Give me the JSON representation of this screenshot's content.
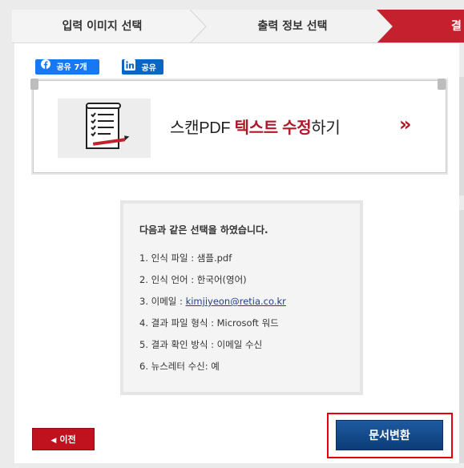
{
  "steps": [
    {
      "label": "입력 이미지 선택"
    },
    {
      "label": "출력 정보 선택"
    },
    {
      "label": "결"
    }
  ],
  "share": {
    "facebook_label": "공유 7개",
    "linkedin_label": "공유"
  },
  "banner": {
    "text_before": "스캔PDF ",
    "text_highlight_1": "텍스트 수정",
    "text_after": "하기",
    "arrow": "»"
  },
  "summary": {
    "title": "다음과 같은 선택을 하였습니다.",
    "items": [
      {
        "label": "1. 인식 파일 : ",
        "value": "샘플.pdf"
      },
      {
        "label": "2. 인식 언어 : ",
        "value": "한국어(영어)"
      },
      {
        "label": "3. 이메일 : ",
        "value": "kimjiyeon@retia.co.kr"
      },
      {
        "label": "4. 결과 파일 형식 : ",
        "value": "Microsoft 워드"
      },
      {
        "label": "5. 결과 확인 방식 : ",
        "value": "이메일 수신"
      },
      {
        "label": "6. 뉴스레터 수신: ",
        "value": "예"
      }
    ]
  },
  "buttons": {
    "prev_label": "이전",
    "convert_label": "문서변환"
  },
  "colors": {
    "active_step": "#c4202e",
    "accent_red": "#b0182a",
    "convert_blue": "#134a8a"
  }
}
